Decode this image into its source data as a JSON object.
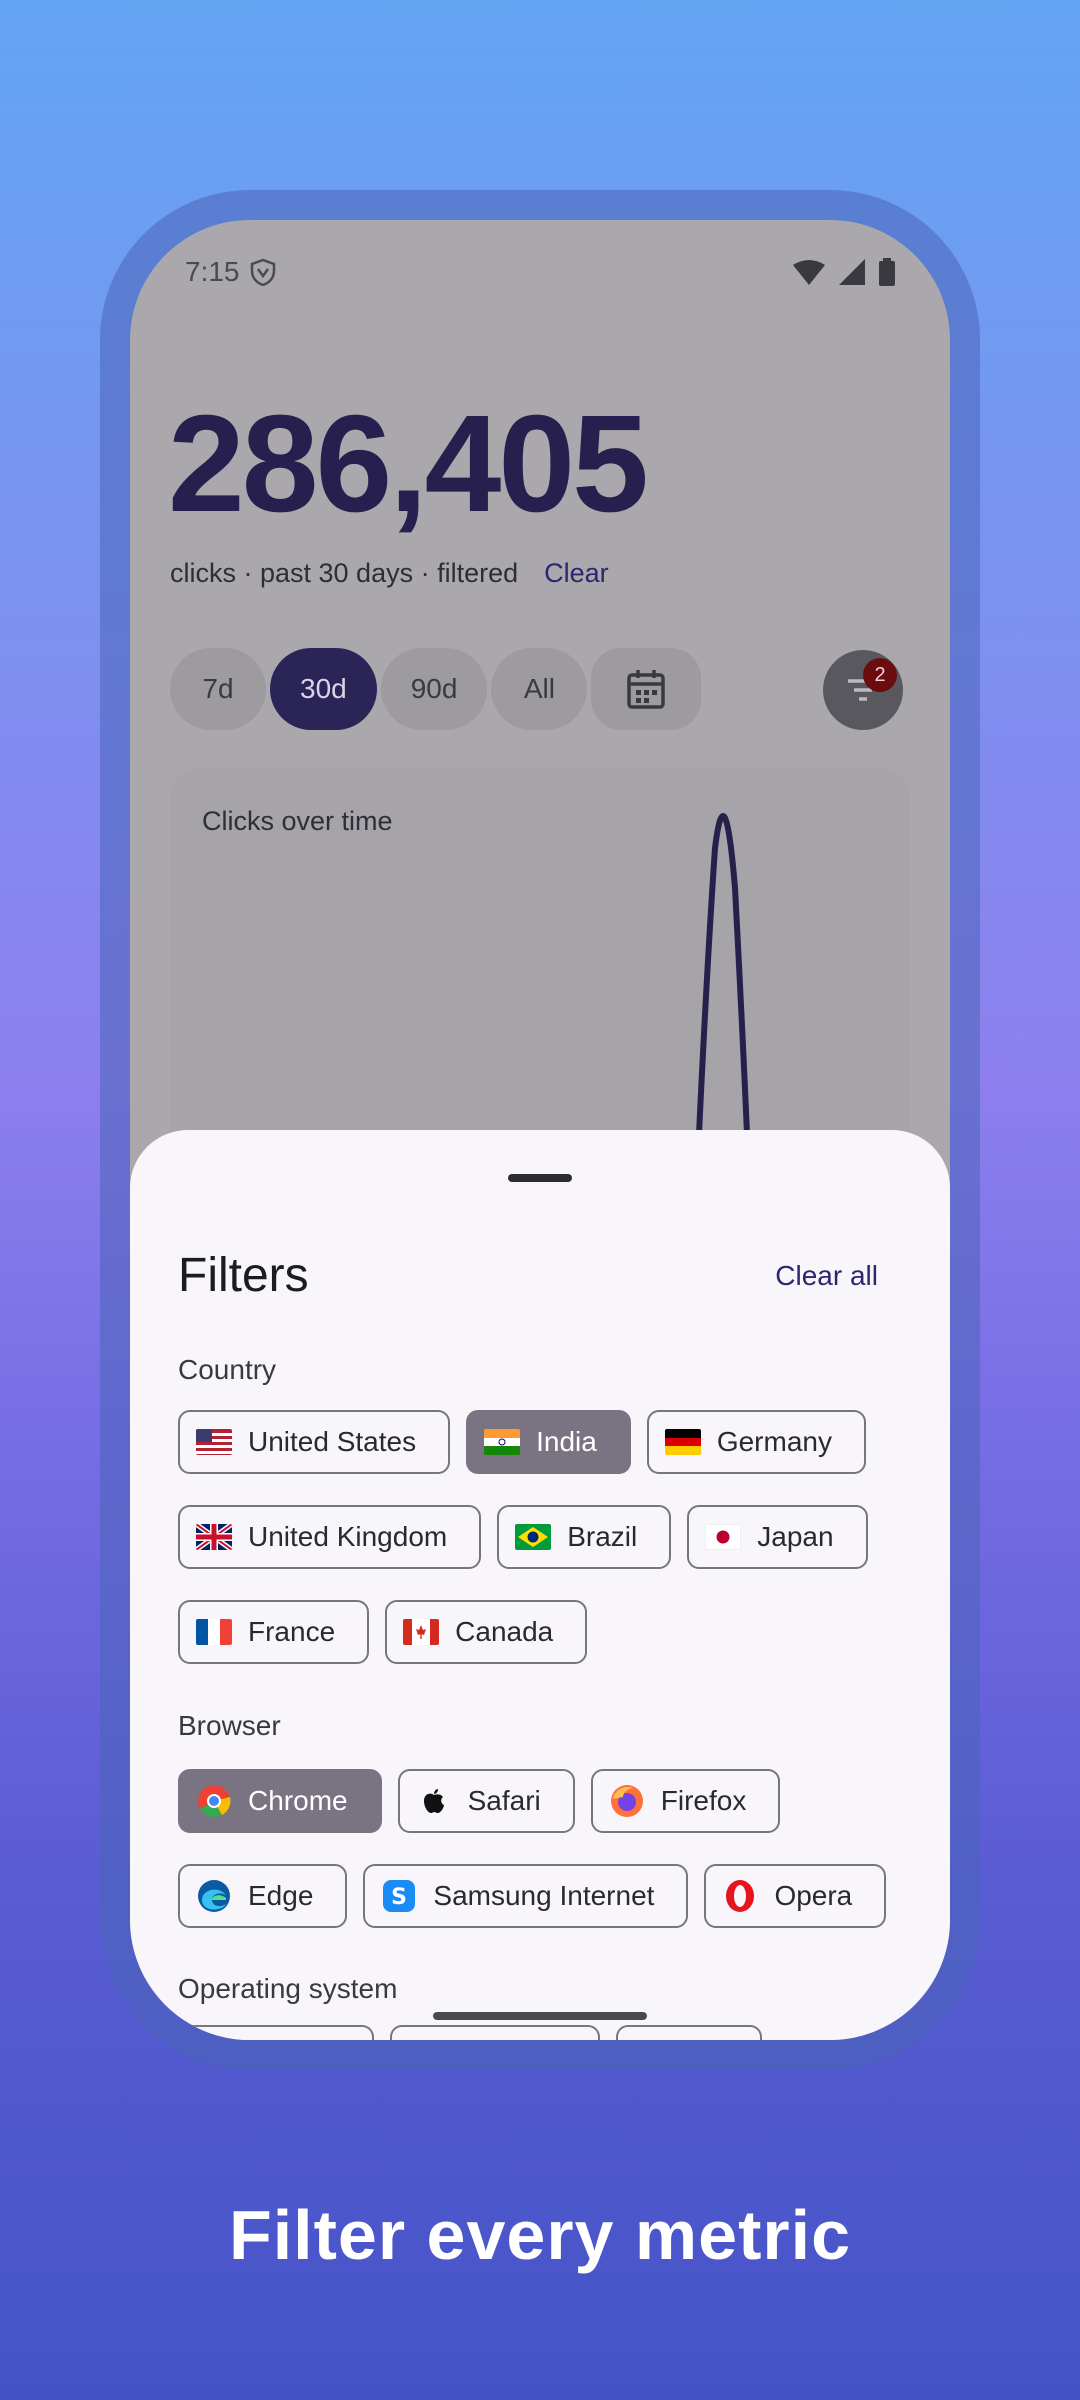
{
  "status": {
    "time": "7:15"
  },
  "stats": {
    "total": "286,405",
    "subtitle": "clicks · past 30 days · filtered",
    "clear_label": "Clear"
  },
  "ranges": [
    {
      "label": "7d",
      "active": false
    },
    {
      "label": "30d",
      "active": true
    },
    {
      "label": "90d",
      "active": false
    },
    {
      "label": "All",
      "active": false
    }
  ],
  "filter_badge": "2",
  "chart": {
    "title": "Clicks over time"
  },
  "sheet": {
    "title": "Filters",
    "clear_all": "Clear all",
    "country_label": "Country",
    "countries": [
      {
        "name": "United States",
        "selected": false
      },
      {
        "name": "India",
        "selected": true
      },
      {
        "name": "Germany",
        "selected": false
      },
      {
        "name": "United Kingdom",
        "selected": false
      },
      {
        "name": "Brazil",
        "selected": false
      },
      {
        "name": "Japan",
        "selected": false
      },
      {
        "name": "France",
        "selected": false
      },
      {
        "name": "Canada",
        "selected": false
      }
    ],
    "browser_label": "Browser",
    "browsers": [
      {
        "name": "Chrome",
        "selected": true
      },
      {
        "name": "Safari",
        "selected": false
      },
      {
        "name": "Firefox",
        "selected": false
      },
      {
        "name": "Edge",
        "selected": false
      },
      {
        "name": "Samsung Internet",
        "selected": false
      },
      {
        "name": "Opera",
        "selected": false
      }
    ],
    "os_label": "Operating system"
  },
  "caption": "Filter every metric",
  "colors": {
    "accent": "#2b2457",
    "selected_chip": "#7a7482",
    "sheet_bg": "#f9f6fb"
  }
}
